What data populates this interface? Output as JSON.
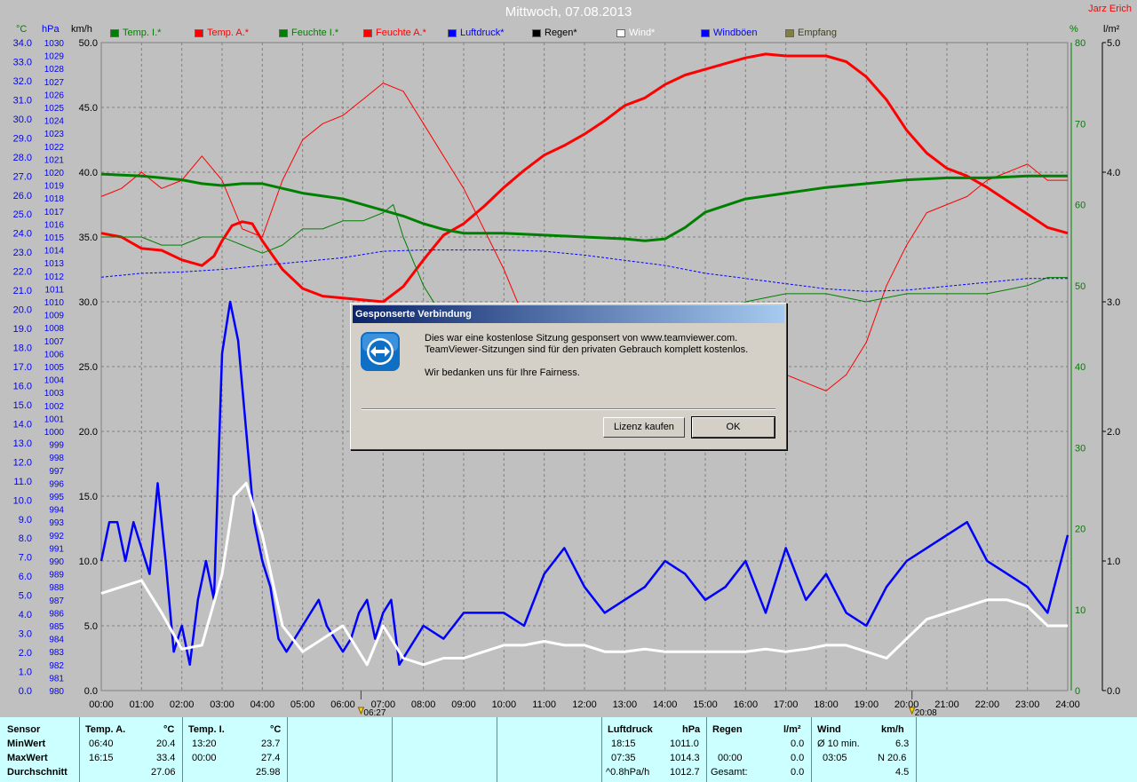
{
  "header": {
    "title": "Mittwoch, 07.08.2013",
    "author": "Jarz Erich"
  },
  "units": {
    "temp": "°C",
    "pressure": "hPa",
    "wind": "km/h",
    "humidity": "%",
    "rain": "l/m²"
  },
  "legend": [
    {
      "label": "Temp. I.*",
      "color": "#008000"
    },
    {
      "label": "Temp. A.*",
      "color": "#ff0000"
    },
    {
      "label": "Feuchte I.*",
      "color": "#008000"
    },
    {
      "label": "Feuchte A.*",
      "color": "#ff0000"
    },
    {
      "label": "Luftdruck*",
      "color": "#0000ff"
    },
    {
      "label": "Regen*",
      "color": "#000000"
    },
    {
      "label": "Wind*",
      "color": "#ffffff"
    },
    {
      "label": "Windböen",
      "color": "#0000ff"
    },
    {
      "label": "Empfang",
      "color": "#808040"
    }
  ],
  "chart_data": {
    "type": "line",
    "title": "Mittwoch, 07.08.2013",
    "x_ticks": [
      "00:00",
      "01:00",
      "02:00",
      "03:00",
      "04:00",
      "05:00",
      "06:00",
      "07:00",
      "08:00",
      "09:00",
      "10:00",
      "11:00",
      "12:00",
      "13:00",
      "14:00",
      "15:00",
      "16:00",
      "17:00",
      "18:00",
      "19:00",
      "20:00",
      "21:00",
      "22:00",
      "23:00",
      "24:00"
    ],
    "temp_ticks": [
      "34.0",
      "33.0",
      "32.0",
      "31.0",
      "30.0",
      "29.0",
      "28.0",
      "27.0",
      "26.0",
      "25.0",
      "24.0",
      "23.0",
      "22.0",
      "21.0",
      "20.0",
      "19.0",
      "18.0",
      "17.0",
      "16.0",
      "15.0",
      "14.0",
      "13.0",
      "12.0",
      "11.0",
      "10.0",
      "9.0",
      "8.0",
      "7.0",
      "6.0",
      "5.0",
      "4.0",
      "3.0",
      "2.0",
      "1.0",
      "0.0"
    ],
    "wind_ticks": [
      "50.0",
      "45.0",
      "40.0",
      "35.0",
      "30.0",
      "25.0",
      "20.0",
      "15.0",
      "10.0",
      "5.0",
      "0.0"
    ],
    "humidity_ticks": [
      "80",
      "70",
      "60",
      "50",
      "40",
      "30",
      "20",
      "10",
      "0"
    ],
    "rain_ticks": [
      "5.0",
      "4.0",
      "3.0",
      "2.0",
      "1.0",
      "0.0"
    ],
    "pressure_range": [
      980,
      1030
    ],
    "sunrise": "06:27",
    "sunset": "20:08",
    "series": [
      {
        "name": "Temp. A.*",
        "axis": "temp",
        "color": "#ff0000",
        "x": [
          0,
          0.5,
          1,
          1.5,
          2,
          2.5,
          2.8,
          3,
          3.25,
          3.5,
          3.75,
          4,
          4.5,
          5,
          5.5,
          6,
          6.5,
          7,
          7.5,
          8,
          8.5,
          9,
          9.5,
          10,
          10.5,
          11,
          11.5,
          12,
          12.5,
          13,
          13.5,
          14,
          14.5,
          15,
          15.5,
          16,
          16.5,
          17,
          17.5,
          18,
          18.5,
          19,
          19.5,
          20,
          20.5,
          21,
          21.5,
          22,
          22.5,
          23,
          23.5,
          24
        ],
        "y": [
          24.0,
          23.8,
          23.2,
          23.1,
          22.6,
          22.3,
          22.8,
          23.6,
          24.4,
          24.6,
          24.5,
          23.6,
          22.1,
          21.1,
          20.7,
          20.6,
          20.5,
          20.4,
          21.2,
          22.6,
          23.9,
          24.5,
          25.4,
          26.4,
          27.3,
          28.1,
          28.6,
          29.2,
          29.9,
          30.7,
          31.1,
          31.8,
          32.3,
          32.6,
          32.9,
          33.2,
          33.4,
          33.3,
          33.3,
          33.3,
          33.0,
          32.2,
          31.0,
          29.4,
          28.2,
          27.4,
          27.0,
          26.4,
          25.7,
          25.0,
          24.3,
          24.0
        ]
      },
      {
        "name": "Feuchte A.*",
        "axis": "humidity",
        "color": "#ff0000",
        "x": [
          0,
          0.5,
          1,
          1.5,
          2,
          2.5,
          3,
          3.5,
          4,
          4.5,
          5,
          5.5,
          6,
          6.5,
          7,
          7.5,
          8,
          8.5,
          9,
          9.5,
          10,
          10.5,
          11,
          12,
          13,
          14,
          15,
          16,
          17,
          17.5,
          18,
          18.5,
          19,
          19.5,
          20,
          20.5,
          21,
          21.5,
          22,
          22.5,
          23,
          23.5,
          24
        ],
        "y": [
          61,
          62,
          64,
          62,
          63,
          66,
          63,
          57,
          56,
          63,
          68,
          70,
          71,
          73,
          75,
          74,
          70,
          66,
          62,
          57,
          52,
          46,
          39,
          37,
          37,
          38,
          38,
          38,
          39,
          38,
          37,
          39,
          43,
          50,
          55,
          59,
          60,
          61,
          63,
          64,
          65,
          63,
          63
        ]
      },
      {
        "name": "Temp. I.*",
        "axis": "temp",
        "color": "#008000",
        "x": [
          0,
          1,
          1.5,
          2,
          2.5,
          3,
          3.5,
          4,
          5,
          6,
          7,
          7.5,
          8,
          8.5,
          9,
          10,
          11,
          12,
          13,
          13.5,
          14,
          14.5,
          15,
          16,
          17,
          18,
          19,
          20,
          21,
          22,
          23,
          24
        ],
        "y": [
          27.1,
          27.0,
          26.9,
          26.8,
          26.6,
          26.5,
          26.6,
          26.6,
          26.1,
          25.8,
          25.2,
          24.9,
          24.5,
          24.2,
          24.0,
          24.0,
          23.9,
          23.8,
          23.7,
          23.6,
          23.7,
          24.3,
          25.1,
          25.8,
          26.1,
          26.4,
          26.6,
          26.8,
          26.9,
          26.9,
          27.0,
          27.0
        ]
      },
      {
        "name": "Feuchte I.*",
        "axis": "humidity",
        "color": "#008000",
        "x": [
          0,
          1,
          1.5,
          2,
          2.5,
          3,
          3.5,
          4,
          4.5,
          5,
          5.5,
          6,
          6.5,
          7,
          7.25,
          7.5,
          8,
          8.5,
          9,
          10,
          11,
          12,
          13,
          14,
          15,
          16,
          17,
          18,
          19,
          20,
          21,
          22,
          23,
          23.5,
          24
        ],
        "y": [
          56,
          56,
          55,
          55,
          56,
          56,
          55,
          54,
          55,
          57,
          57,
          58,
          58,
          59,
          60,
          56,
          50,
          46,
          45,
          44,
          44,
          44,
          44,
          44,
          44,
          48,
          49,
          49,
          48,
          49,
          49,
          49,
          50,
          51,
          51
        ]
      },
      {
        "name": "Luftdruck*",
        "axis": "pressure",
        "color": "#0000ff",
        "x": [
          0,
          1,
          2,
          3,
          4,
          5,
          6,
          7,
          8,
          9,
          10,
          11,
          12,
          13,
          14,
          15,
          16,
          17,
          18,
          19,
          20,
          21,
          22,
          23,
          24
        ],
        "y": [
          1011.9,
          1012.2,
          1012.3,
          1012.5,
          1012.8,
          1013.1,
          1013.4,
          1013.9,
          1014.0,
          1014.0,
          1014.0,
          1013.9,
          1013.6,
          1013.2,
          1012.8,
          1012.2,
          1011.8,
          1011.4,
          1011.0,
          1010.8,
          1010.9,
          1011.2,
          1011.5,
          1011.8,
          1011.8
        ]
      },
      {
        "name": "Windböen",
        "axis": "wind",
        "color": "#0000ff",
        "x": [
          0,
          0.2,
          0.4,
          0.6,
          0.8,
          1,
          1.2,
          1.4,
          1.6,
          1.8,
          2,
          2.2,
          2.4,
          2.6,
          2.8,
          3,
          3.2,
          3.4,
          3.6,
          3.8,
          4,
          4.2,
          4.4,
          4.6,
          4.8,
          5,
          5.2,
          5.4,
          5.6,
          5.8,
          6,
          6.2,
          6.4,
          6.6,
          6.8,
          7,
          7.2,
          7.4,
          7.6,
          7.8,
          8,
          8.5,
          9,
          9.5,
          10,
          10.5,
          11,
          11.5,
          12,
          12.5,
          13,
          13.5,
          14,
          14.5,
          15,
          15.5,
          16,
          16.5,
          17,
          17.5,
          18,
          18.5,
          19,
          19.5,
          20,
          20.5,
          21,
          21.5,
          22,
          22.5,
          23,
          23.5,
          24
        ],
        "y": [
          10,
          13,
          13,
          10,
          13,
          11,
          9,
          16,
          10,
          3,
          5,
          2,
          7,
          10,
          7,
          26,
          30,
          27,
          20,
          13,
          10,
          8,
          4,
          3,
          4,
          5,
          6,
          7,
          5,
          4,
          3,
          4,
          6,
          7,
          4,
          6,
          7,
          2,
          3,
          4,
          5,
          4,
          6,
          6,
          6,
          5,
          9,
          11,
          8,
          6,
          7,
          8,
          10,
          9,
          7,
          8,
          10,
          6,
          11,
          7,
          9,
          6,
          5,
          8,
          10,
          11,
          12,
          13,
          10,
          9,
          8,
          6,
          12
        ]
      },
      {
        "name": "Wind*",
        "axis": "wind",
        "color": "#ffffff",
        "x": [
          0,
          0.5,
          1,
          1.5,
          2,
          2.5,
          3,
          3.3,
          3.6,
          4,
          4.5,
          5,
          5.5,
          6,
          6.3,
          6.6,
          7,
          7.5,
          8,
          8.5,
          9,
          9.5,
          10,
          10.5,
          11,
          11.5,
          12,
          12.5,
          13,
          13.5,
          14,
          14.5,
          15,
          15.5,
          16,
          16.5,
          17,
          17.5,
          18,
          18.5,
          19,
          19.5,
          20,
          20.5,
          21,
          21.5,
          22,
          22.5,
          23,
          23.5,
          24
        ],
        "y": [
          7.5,
          8.0,
          8.5,
          6.0,
          3.2,
          3.5,
          9.0,
          15.0,
          16.0,
          12.0,
          5.0,
          3.0,
          4.0,
          5.0,
          3.5,
          2.0,
          5.0,
          2.5,
          2.0,
          2.5,
          2.5,
          3.0,
          3.5,
          3.5,
          3.8,
          3.5,
          3.5,
          3.0,
          3.0,
          3.2,
          3.0,
          3.0,
          3.0,
          3.0,
          3.0,
          3.2,
          3.0,
          3.2,
          3.5,
          3.5,
          3.0,
          2.5,
          4.0,
          5.5,
          6.0,
          6.5,
          7.0,
          7.0,
          6.5,
          5.0,
          5.0
        ]
      }
    ]
  },
  "dialog": {
    "title": "Gesponserte Verbindung",
    "line1": "Dies war eine kostenlose Sitzung gesponsert von www.teamviewer.com.",
    "line2": "TeamViewer-Sitzungen sind für den privaten Gebrauch komplett kostenlos.",
    "line3": "Wir bedanken uns für Ihre Fairness.",
    "btn_buy": "Lizenz kaufen",
    "btn_ok": "OK"
  },
  "stats": {
    "sensor": {
      "h": "Sensor",
      "r1": "MinWert",
      "r2": "MaxWert",
      "r3": "Durchschnitt"
    },
    "tempA": {
      "h": "Temp. A.",
      "u": "°C",
      "r1t": "06:40",
      "r1v": "20.4",
      "r2t": "16:15",
      "r2v": "33.4",
      "r3v": "27.06"
    },
    "tempI": {
      "h": "Temp. I.",
      "u": "°C",
      "r1t": "13:20",
      "r1v": "23.7",
      "r2t": "00:00",
      "r2v": "27.4",
      "r3v": "25.98"
    },
    "press": {
      "h": "Luftdruck",
      "u": "hPa",
      "r1t": "18:15",
      "r1v": "1011.0",
      "r2t": "07:35",
      "r2v": "1014.3",
      "r3t": "^0.8hPa/h",
      "r3v": "1012.7"
    },
    "rain": {
      "h": "Regen",
      "u": "l/m²",
      "r2t": "00:00",
      "r2v": "0.0",
      "r3t": "Gesamt:",
      "r3v": "0.0",
      "r1v": "0.0"
    },
    "wind": {
      "h": "Wind",
      "u": "km/h",
      "r1t": "Ø 10 min.",
      "r1v": "6.3",
      "r2t": "03:05",
      "r2v": "N 20.6",
      "r3v": "4.5"
    }
  }
}
